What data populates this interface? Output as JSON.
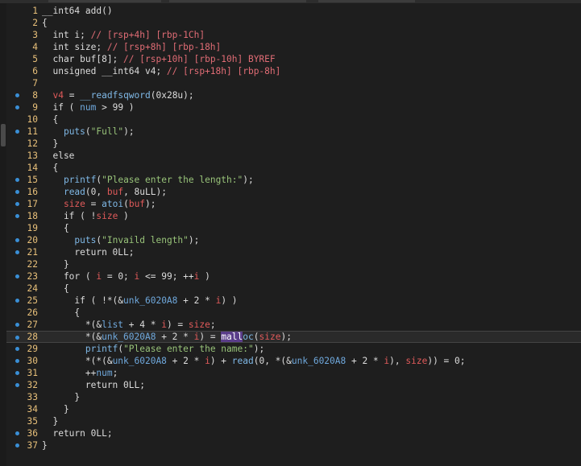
{
  "editor": {
    "lines": [
      {
        "n": "1",
        "bp": false,
        "code": [
          {
            "t": "__int64 add()",
            "c": "k"
          }
        ]
      },
      {
        "n": "2",
        "bp": false,
        "code": [
          {
            "t": "{",
            "c": "k"
          }
        ]
      },
      {
        "n": "3",
        "bp": false,
        "code": [
          {
            "t": "  int i; ",
            "c": "k"
          },
          {
            "t": "// [rsp+4h] [rbp-1Ch]",
            "c": "c"
          }
        ]
      },
      {
        "n": "4",
        "bp": false,
        "code": [
          {
            "t": "  int size; ",
            "c": "k"
          },
          {
            "t": "// [rsp+8h] [rbp-18h]",
            "c": "c"
          }
        ]
      },
      {
        "n": "5",
        "bp": false,
        "code": [
          {
            "t": "  char buf[8]; ",
            "c": "k"
          },
          {
            "t": "// [rsp+10h] [rbp-10h] BYREF",
            "c": "c"
          }
        ]
      },
      {
        "n": "6",
        "bp": false,
        "code": [
          {
            "t": "  unsigned __int64 v4; ",
            "c": "k"
          },
          {
            "t": "// [rsp+18h] [rbp-8h]",
            "c": "c"
          }
        ]
      },
      {
        "n": "7",
        "bp": false,
        "code": [
          {
            "t": "",
            "c": "k"
          }
        ]
      },
      {
        "n": "8",
        "bp": true,
        "code": [
          {
            "t": "  ",
            "c": "k"
          },
          {
            "t": "v4",
            "c": "g"
          },
          {
            "t": " = ",
            "c": "k"
          },
          {
            "t": "__readfsqword",
            "c": "fn"
          },
          {
            "t": "(0x28u);",
            "c": "k"
          }
        ]
      },
      {
        "n": "9",
        "bp": true,
        "code": [
          {
            "t": "  if ( ",
            "c": "k"
          },
          {
            "t": "num",
            "c": "d"
          },
          {
            "t": " > 99 )",
            "c": "k"
          }
        ]
      },
      {
        "n": "10",
        "bp": false,
        "code": [
          {
            "t": "  {",
            "c": "k"
          }
        ]
      },
      {
        "n": "11",
        "bp": true,
        "code": [
          {
            "t": "    ",
            "c": "k"
          },
          {
            "t": "puts",
            "c": "fn"
          },
          {
            "t": "(",
            "c": "k"
          },
          {
            "t": "\"Full\"",
            "c": "s"
          },
          {
            "t": ");",
            "c": "k"
          }
        ]
      },
      {
        "n": "12",
        "bp": false,
        "code": [
          {
            "t": "  }",
            "c": "k"
          }
        ]
      },
      {
        "n": "13",
        "bp": false,
        "code": [
          {
            "t": "  else",
            "c": "k"
          }
        ]
      },
      {
        "n": "14",
        "bp": false,
        "code": [
          {
            "t": "  {",
            "c": "k"
          }
        ]
      },
      {
        "n": "15",
        "bp": true,
        "code": [
          {
            "t": "    ",
            "c": "k"
          },
          {
            "t": "printf",
            "c": "fn"
          },
          {
            "t": "(",
            "c": "k"
          },
          {
            "t": "\"Please enter the length:\"",
            "c": "s"
          },
          {
            "t": ");",
            "c": "k"
          }
        ]
      },
      {
        "n": "16",
        "bp": true,
        "code": [
          {
            "t": "    ",
            "c": "k"
          },
          {
            "t": "read",
            "c": "fn"
          },
          {
            "t": "(0, ",
            "c": "k"
          },
          {
            "t": "buf",
            "c": "g"
          },
          {
            "t": ", 8uLL);",
            "c": "k"
          }
        ]
      },
      {
        "n": "17",
        "bp": true,
        "code": [
          {
            "t": "    ",
            "c": "k"
          },
          {
            "t": "size",
            "c": "g"
          },
          {
            "t": " = ",
            "c": "k"
          },
          {
            "t": "atoi",
            "c": "fn"
          },
          {
            "t": "(",
            "c": "k"
          },
          {
            "t": "buf",
            "c": "g"
          },
          {
            "t": ");",
            "c": "k"
          }
        ]
      },
      {
        "n": "18",
        "bp": true,
        "code": [
          {
            "t": "    if ( !",
            "c": "k"
          },
          {
            "t": "size",
            "c": "g"
          },
          {
            "t": " )",
            "c": "k"
          }
        ]
      },
      {
        "n": "19",
        "bp": false,
        "code": [
          {
            "t": "    {",
            "c": "k"
          }
        ]
      },
      {
        "n": "20",
        "bp": true,
        "code": [
          {
            "t": "      ",
            "c": "k"
          },
          {
            "t": "puts",
            "c": "fn"
          },
          {
            "t": "(",
            "c": "k"
          },
          {
            "t": "\"Invaild length\"",
            "c": "s"
          },
          {
            "t": ");",
            "c": "k"
          }
        ]
      },
      {
        "n": "21",
        "bp": true,
        "code": [
          {
            "t": "      return 0LL;",
            "c": "k"
          }
        ]
      },
      {
        "n": "22",
        "bp": false,
        "code": [
          {
            "t": "    }",
            "c": "k"
          }
        ]
      },
      {
        "n": "23",
        "bp": true,
        "code": [
          {
            "t": "    for ( ",
            "c": "k"
          },
          {
            "t": "i",
            "c": "g"
          },
          {
            "t": " = 0; ",
            "c": "k"
          },
          {
            "t": "i",
            "c": "g"
          },
          {
            "t": " <= 99; ++",
            "c": "k"
          },
          {
            "t": "i",
            "c": "g"
          },
          {
            "t": " )",
            "c": "k"
          }
        ]
      },
      {
        "n": "24",
        "bp": false,
        "code": [
          {
            "t": "    {",
            "c": "k"
          }
        ]
      },
      {
        "n": "25",
        "bp": true,
        "code": [
          {
            "t": "      if ( !*(&",
            "c": "k"
          },
          {
            "t": "unk_6020A8",
            "c": "d"
          },
          {
            "t": " + 2 * ",
            "c": "k"
          },
          {
            "t": "i",
            "c": "g"
          },
          {
            "t": ") )",
            "c": "k"
          }
        ]
      },
      {
        "n": "26",
        "bp": false,
        "code": [
          {
            "t": "      {",
            "c": "k"
          }
        ]
      },
      {
        "n": "27",
        "bp": true,
        "code": [
          {
            "t": "        *(&",
            "c": "k"
          },
          {
            "t": "list",
            "c": "d"
          },
          {
            "t": " + 4 * ",
            "c": "k"
          },
          {
            "t": "i",
            "c": "g"
          },
          {
            "t": ") = ",
            "c": "k"
          },
          {
            "t": "size",
            "c": "g"
          },
          {
            "t": ";",
            "c": "k"
          }
        ]
      },
      {
        "n": "28",
        "bp": true,
        "hl": true,
        "code": [
          {
            "t": "        *(&",
            "c": "k"
          },
          {
            "t": "unk_6020A8",
            "c": "d"
          },
          {
            "t": " + 2 * ",
            "c": "k"
          },
          {
            "t": "i",
            "c": "g"
          },
          {
            "t": ") = ",
            "c": "k"
          },
          {
            "t": "mall",
            "c": "mk"
          },
          {
            "t": "oc",
            "c": "fn"
          },
          {
            "t": "(",
            "c": "k"
          },
          {
            "t": "size",
            "c": "g"
          },
          {
            "t": ");",
            "c": "k"
          }
        ]
      },
      {
        "n": "29",
        "bp": true,
        "code": [
          {
            "t": "        ",
            "c": "k"
          },
          {
            "t": "printf",
            "c": "fn"
          },
          {
            "t": "(",
            "c": "k"
          },
          {
            "t": "\"Please enter the name:\"",
            "c": "s"
          },
          {
            "t": ");",
            "c": "k"
          }
        ]
      },
      {
        "n": "30",
        "bp": true,
        "code": [
          {
            "t": "        *(*(&",
            "c": "k"
          },
          {
            "t": "unk_6020A8",
            "c": "d"
          },
          {
            "t": " + 2 * ",
            "c": "k"
          },
          {
            "t": "i",
            "c": "g"
          },
          {
            "t": ") + ",
            "c": "k"
          },
          {
            "t": "read",
            "c": "fn"
          },
          {
            "t": "(0, *(&",
            "c": "k"
          },
          {
            "t": "unk_6020A8",
            "c": "d"
          },
          {
            "t": " + 2 * ",
            "c": "k"
          },
          {
            "t": "i",
            "c": "g"
          },
          {
            "t": "), ",
            "c": "k"
          },
          {
            "t": "size",
            "c": "g"
          },
          {
            "t": ")) = 0;",
            "c": "k"
          }
        ]
      },
      {
        "n": "31",
        "bp": true,
        "code": [
          {
            "t": "        ++",
            "c": "k"
          },
          {
            "t": "num",
            "c": "d"
          },
          {
            "t": ";",
            "c": "k"
          }
        ]
      },
      {
        "n": "32",
        "bp": true,
        "code": [
          {
            "t": "        return 0LL;",
            "c": "k"
          }
        ]
      },
      {
        "n": "33",
        "bp": false,
        "code": [
          {
            "t": "      }",
            "c": "k"
          }
        ]
      },
      {
        "n": "34",
        "bp": false,
        "code": [
          {
            "t": "    }",
            "c": "k"
          }
        ]
      },
      {
        "n": "35",
        "bp": false,
        "code": [
          {
            "t": "  }",
            "c": "k"
          }
        ]
      },
      {
        "n": "36",
        "bp": true,
        "code": [
          {
            "t": "  return 0LL;",
            "c": "k"
          }
        ]
      },
      {
        "n": "37",
        "bp": true,
        "code": [
          {
            "t": "}",
            "c": "k"
          }
        ]
      }
    ]
  }
}
